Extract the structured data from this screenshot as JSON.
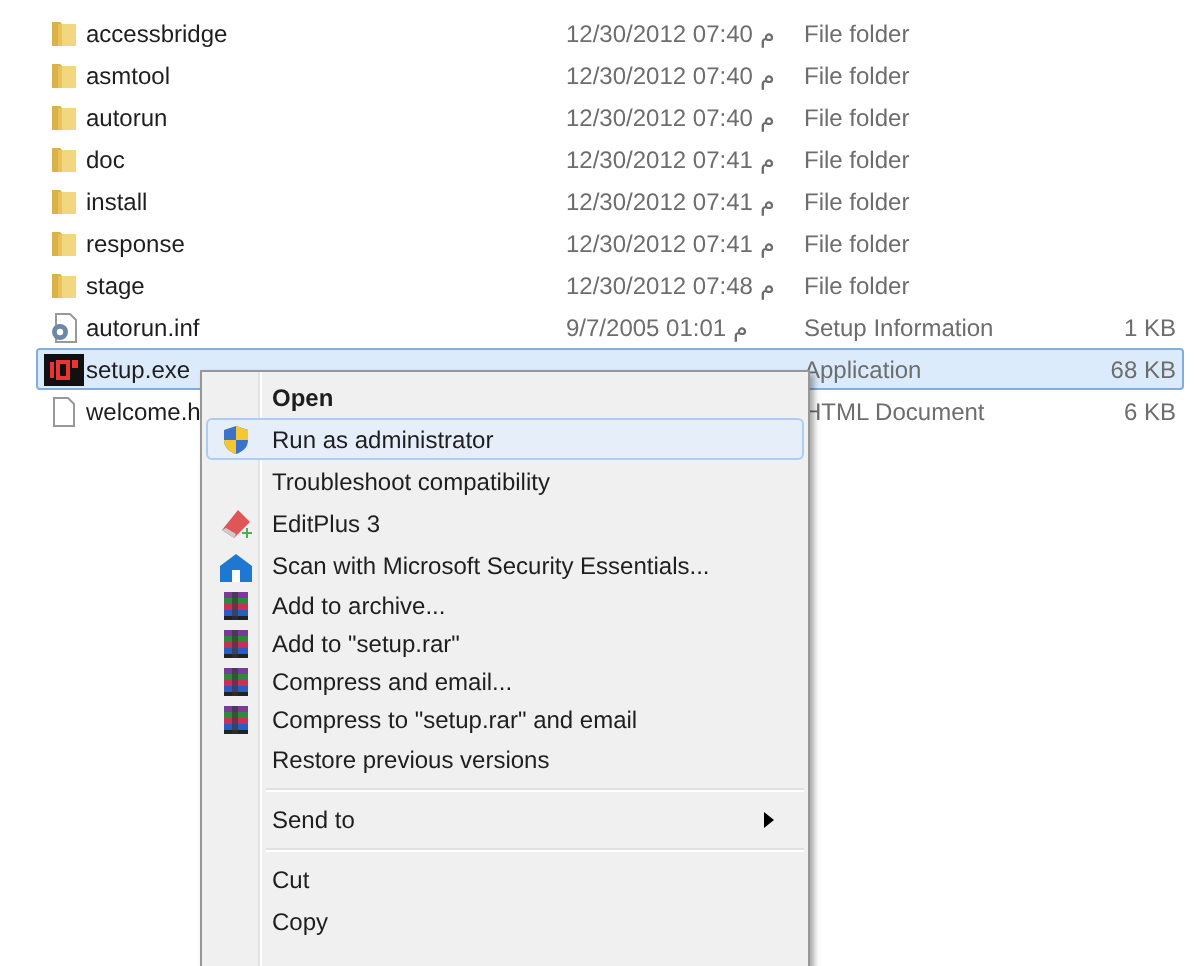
{
  "files": [
    {
      "name": "accessbridge",
      "date": "12/30/2012 07:40 م",
      "type": "File folder",
      "kind": "folder",
      "selected": false
    },
    {
      "name": "asmtool",
      "date": "12/30/2012 07:40 م",
      "type": "File folder",
      "kind": "folder",
      "selected": false
    },
    {
      "name": "autorun",
      "date": "12/30/2012 07:40 م",
      "type": "File folder",
      "kind": "folder",
      "selected": false
    },
    {
      "name": "doc",
      "date": "12/30/2012 07:41 م",
      "type": "File folder",
      "kind": "folder",
      "selected": false
    },
    {
      "name": "install",
      "date": "12/30/2012 07:41 م",
      "type": "File folder",
      "kind": "folder",
      "selected": false
    },
    {
      "name": "response",
      "date": "12/30/2012 07:41 م",
      "type": "File folder",
      "kind": "folder",
      "selected": false
    },
    {
      "name": "stage",
      "date": "12/30/2012 07:48 م",
      "type": "File folder",
      "kind": "folder",
      "selected": false
    },
    {
      "name": "autorun.inf",
      "date": "9/7/2005 01:01 م",
      "type": "Setup Information",
      "size": "1 KB",
      "kind": "settings",
      "selected": false
    },
    {
      "name": "setup.exe",
      "type": "Application",
      "size": "68 KB",
      "kind": "app",
      "selected": true
    },
    {
      "name": "welcome.h",
      "type": "HTML Document",
      "size": "6 KB",
      "kind": "document",
      "selected": false
    }
  ],
  "context_menu": {
    "items": [
      {
        "kind": "plain",
        "label": "Open",
        "default": true,
        "highlighted": false
      },
      {
        "kind": "shield",
        "label": "Run as administrator",
        "default": false,
        "highlighted": true
      },
      {
        "kind": "plain",
        "label": "Troubleshoot compatibility",
        "default": false,
        "highlighted": false
      },
      {
        "kind": "pen",
        "label": "EditPlus 3",
        "default": false,
        "highlighted": false
      },
      {
        "kind": "scan",
        "label": "Scan with Microsoft Security Essentials...",
        "default": false,
        "highlighted": false
      },
      {
        "kind": "archive",
        "label": "Add to archive...",
        "default": false,
        "highlighted": false
      },
      {
        "kind": "archive",
        "label": "Add to \"setup.rar\"",
        "default": false,
        "highlighted": false
      },
      {
        "kind": "archive",
        "label": "Compress and email...",
        "default": false,
        "highlighted": false
      },
      {
        "kind": "archive",
        "label": "Compress to \"setup.rar\" and email",
        "default": false,
        "highlighted": false
      },
      {
        "kind": "plain",
        "label": "Restore previous versions",
        "default": false,
        "highlighted": false
      },
      {
        "kind": "separator"
      },
      {
        "kind": "submenu",
        "label": "Send to",
        "default": false,
        "highlighted": false
      },
      {
        "kind": "separator"
      },
      {
        "kind": "plain",
        "label": "Cut",
        "default": false,
        "highlighted": false
      },
      {
        "kind": "plain",
        "label": "Copy",
        "default": false,
        "highlighted": false
      }
    ]
  }
}
